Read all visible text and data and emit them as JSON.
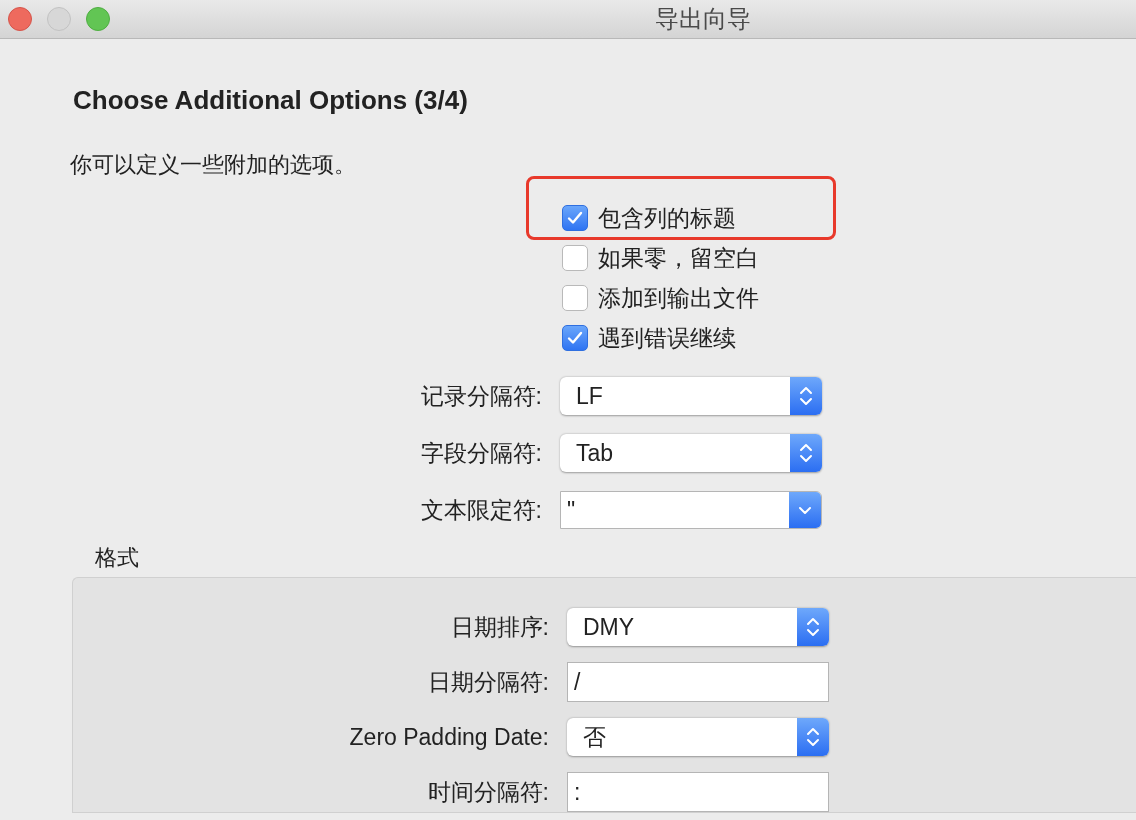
{
  "window": {
    "title": "导出向导"
  },
  "heading": "Choose Additional Options (3/4)",
  "description": "你可以定义一些附加的选项。",
  "options": [
    {
      "label": "包含列的标题",
      "checked": true
    },
    {
      "label": "如果零，留空白",
      "checked": false
    },
    {
      "label": "添加到输出文件",
      "checked": false
    },
    {
      "label": "遇到错误继续",
      "checked": true
    }
  ],
  "fields": [
    {
      "label": "记录分隔符:",
      "kind": "popup",
      "value": "LF"
    },
    {
      "label": "字段分隔符:",
      "kind": "popup",
      "value": "Tab"
    },
    {
      "label": "文本限定符:",
      "kind": "combo",
      "value": "\""
    }
  ],
  "format": {
    "title": "格式",
    "fields": [
      {
        "label": "日期排序:",
        "kind": "popup",
        "value": "DMY"
      },
      {
        "label": "日期分隔符:",
        "kind": "text",
        "value": "/"
      },
      {
        "label": "Zero Padding Date:",
        "kind": "popup",
        "value": "否"
      },
      {
        "label": "时间分隔符:",
        "kind": "text",
        "value": ":"
      }
    ]
  }
}
